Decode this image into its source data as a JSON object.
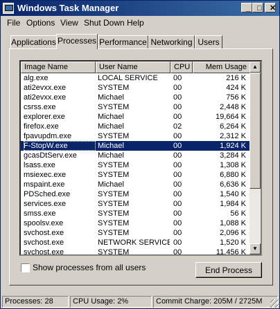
{
  "window": {
    "title": "Windows Task Manager"
  },
  "title_buttons": {
    "minimize": "_",
    "maximize": "□",
    "close": "✕"
  },
  "menu": [
    {
      "label": "File"
    },
    {
      "label": "Options"
    },
    {
      "label": "View"
    },
    {
      "label": "Shut Down"
    },
    {
      "label": "Help"
    }
  ],
  "tabs": [
    {
      "label": "Applications",
      "active": false
    },
    {
      "label": "Processes",
      "active": true
    },
    {
      "label": "Performance",
      "active": false
    },
    {
      "label": "Networking",
      "active": false
    },
    {
      "label": "Users",
      "active": false
    }
  ],
  "columns": [
    "Image Name",
    "User Name",
    "CPU",
    "Mem Usage"
  ],
  "processes": [
    {
      "name": "alg.exe",
      "user": "LOCAL SERVICE",
      "cpu": "00",
      "mem": "216 K",
      "selected": false
    },
    {
      "name": "ati2evxx.exe",
      "user": "SYSTEM",
      "cpu": "00",
      "mem": "424 K",
      "selected": false
    },
    {
      "name": "ati2evxx.exe",
      "user": "Michael",
      "cpu": "00",
      "mem": "756 K",
      "selected": false
    },
    {
      "name": "csrss.exe",
      "user": "SYSTEM",
      "cpu": "00",
      "mem": "2,448 K",
      "selected": false
    },
    {
      "name": "explorer.exe",
      "user": "Michael",
      "cpu": "00",
      "mem": "19,664 K",
      "selected": false
    },
    {
      "name": "firefox.exe",
      "user": "Michael",
      "cpu": "02",
      "mem": "6,264 K",
      "selected": false
    },
    {
      "name": "fpavupdm.exe",
      "user": "SYSTEM",
      "cpu": "00",
      "mem": "2,312 K",
      "selected": false
    },
    {
      "name": "F-StopW.exe",
      "user": "Michael",
      "cpu": "00",
      "mem": "1,924 K",
      "selected": true
    },
    {
      "name": "gcasDtServ.exe",
      "user": "Michael",
      "cpu": "00",
      "mem": "3,284 K",
      "selected": false
    },
    {
      "name": "lsass.exe",
      "user": "SYSTEM",
      "cpu": "00",
      "mem": "1,308 K",
      "selected": false
    },
    {
      "name": "msiexec.exe",
      "user": "SYSTEM",
      "cpu": "00",
      "mem": "6,880 K",
      "selected": false
    },
    {
      "name": "mspaint.exe",
      "user": "Michael",
      "cpu": "00",
      "mem": "6,636 K",
      "selected": false
    },
    {
      "name": "PDSched.exe",
      "user": "SYSTEM",
      "cpu": "00",
      "mem": "1,540 K",
      "selected": false
    },
    {
      "name": "services.exe",
      "user": "SYSTEM",
      "cpu": "00",
      "mem": "1,984 K",
      "selected": false
    },
    {
      "name": "smss.exe",
      "user": "SYSTEM",
      "cpu": "00",
      "mem": "56 K",
      "selected": false
    },
    {
      "name": "spoolsv.exe",
      "user": "SYSTEM",
      "cpu": "00",
      "mem": "1,088 K",
      "selected": false
    },
    {
      "name": "svchost.exe",
      "user": "SYSTEM",
      "cpu": "00",
      "mem": "2,096 K",
      "selected": false
    },
    {
      "name": "svchost.exe",
      "user": "NETWORK SERVICE",
      "cpu": "00",
      "mem": "1,520 K",
      "selected": false
    },
    {
      "name": "svchost.exe",
      "user": "SYSTEM",
      "cpu": "00",
      "mem": "11,456 K",
      "selected": false
    }
  ],
  "show_all_users": {
    "label": "Show processes from all users",
    "checked": false
  },
  "end_process_label": "End Process",
  "status": {
    "processes": "Processes: 28",
    "cpu": "CPU Usage: 2%",
    "commit": "Commit Charge: 205M / 2725M"
  },
  "colors": {
    "title_start": "#0a246a",
    "title_end": "#3a6ea5",
    "selection": "#0a246a",
    "face": "#d4d0c8"
  }
}
